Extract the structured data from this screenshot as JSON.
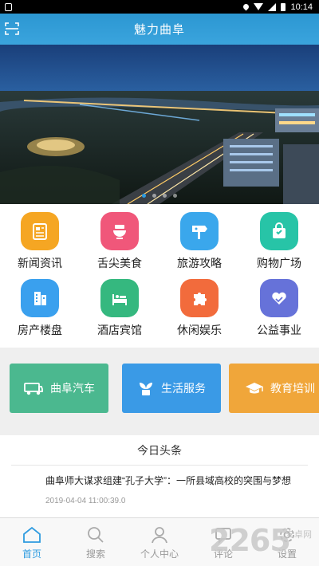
{
  "status_bar": {
    "time": "10:14"
  },
  "header": {
    "title": "魅力曲阜"
  },
  "banner": {
    "slide_count": 4,
    "active_index": 0
  },
  "categories": [
    {
      "label": "新闻资讯",
      "color": "#f5a623",
      "icon": "newspaper-icon"
    },
    {
      "label": "舌尖美食",
      "color": "#f0577a",
      "icon": "food-bowl-icon"
    },
    {
      "label": "旅游攻略",
      "color": "#3aa7ec",
      "icon": "signpost-icon"
    },
    {
      "label": "购物广场",
      "color": "#27c4a7",
      "icon": "shopping-bag-icon"
    },
    {
      "label": "房产楼盘",
      "color": "#3aa0ee",
      "icon": "building-icon"
    },
    {
      "label": "酒店宾馆",
      "color": "#35b87f",
      "icon": "hotel-bed-icon"
    },
    {
      "label": "休闲娱乐",
      "color": "#f26b3c",
      "icon": "puzzle-icon"
    },
    {
      "label": "公益事业",
      "color": "#6672d9",
      "icon": "heart-hands-icon"
    }
  ],
  "services": [
    {
      "label": "曲阜汽车",
      "color": "#4bb88f",
      "icon": "car-icon"
    },
    {
      "label": "生活服务",
      "color": "#3a9ae6",
      "icon": "plant-icon"
    },
    {
      "label": "教育培训",
      "color": "#f0a63a",
      "icon": "graduation-cap-icon"
    }
  ],
  "news": {
    "heading": "今日头条",
    "items": [
      {
        "title": "曲阜师大谋求组建“孔子大学”：一所县域高校的突围与梦想",
        "time": "2019-04-04 11:00:39.0"
      }
    ]
  },
  "tabs": [
    {
      "label": "首页",
      "icon": "home-icon",
      "active": true
    },
    {
      "label": "搜索",
      "icon": "search-icon",
      "active": false
    },
    {
      "label": "个人中心",
      "icon": "user-icon",
      "active": false
    },
    {
      "label": "评论",
      "icon": "comment-icon",
      "active": false
    },
    {
      "label": "设置",
      "icon": "settings-icon",
      "active": false
    }
  ],
  "watermark": {
    "number": "2265",
    "text": "安卓网"
  }
}
